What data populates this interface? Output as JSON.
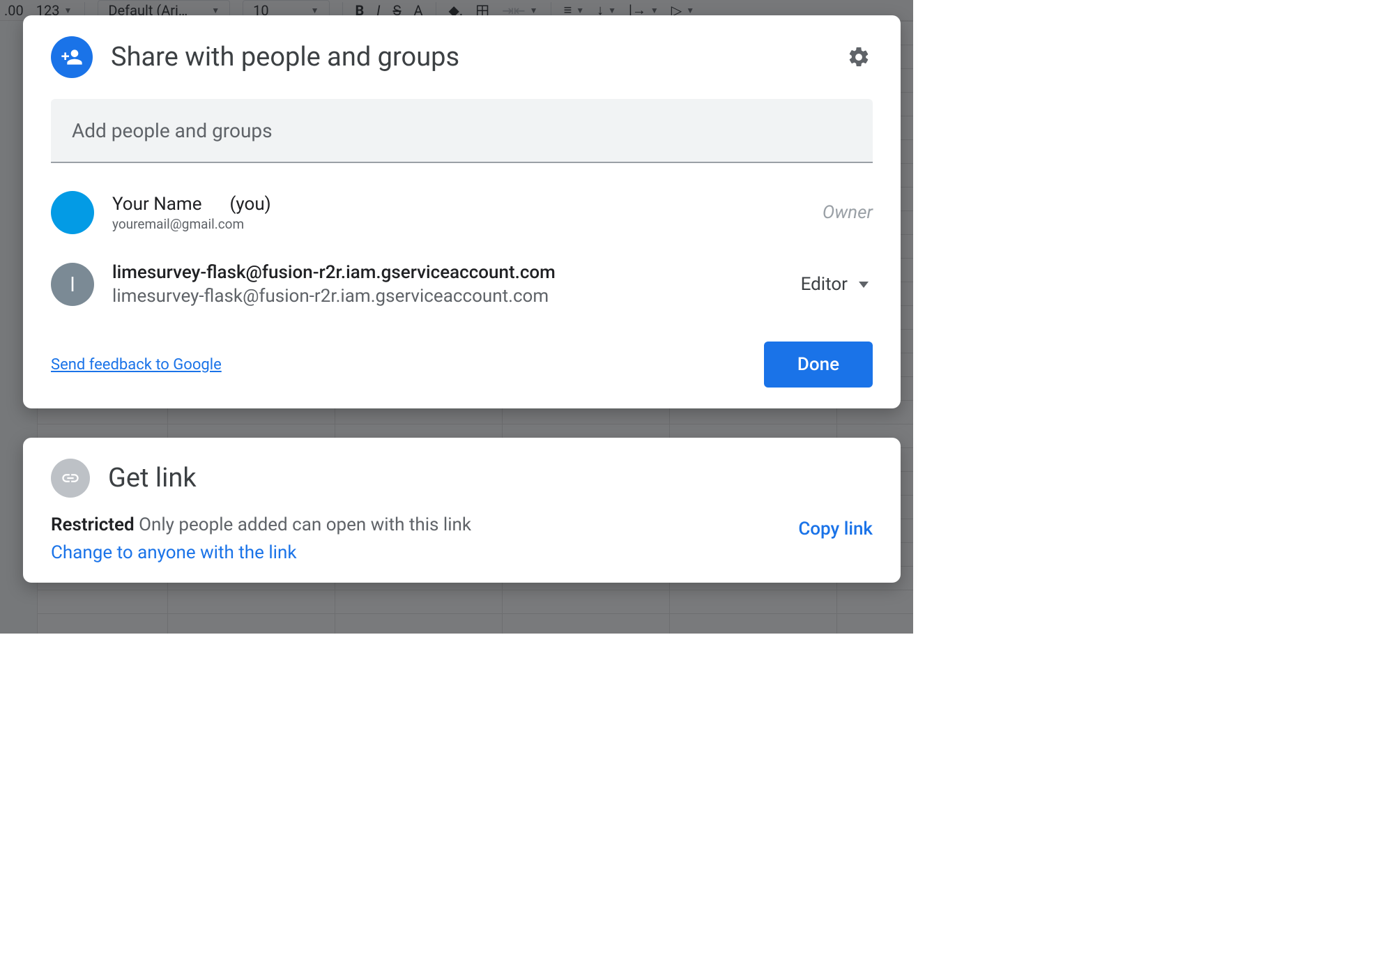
{
  "toolbar": {
    "decimals": ".00",
    "numfmt": "123",
    "font": "Default (Ari…",
    "size": "10"
  },
  "share": {
    "title": "Share with people and groups",
    "input_placeholder": "Add people and groups",
    "people": [
      {
        "name": "Your Name",
        "you_suffix": "(you)",
        "email": "youremail@gmail.com",
        "role": "Owner"
      },
      {
        "name": "limesurvey-flask@fusion-r2r.iam.gserviceaccount.com",
        "email": "limesurvey-flask@fusion-r2r.iam.gserviceaccount.com",
        "avatar_letter": "l",
        "role": "Editor"
      }
    ],
    "feedback": "Send feedback to Google",
    "done": "Done"
  },
  "link": {
    "title": "Get link",
    "restricted_bold": "Restricted",
    "restricted_rest": "Only people added can open with this link",
    "change": "Change to anyone with the link",
    "copy": "Copy link"
  }
}
